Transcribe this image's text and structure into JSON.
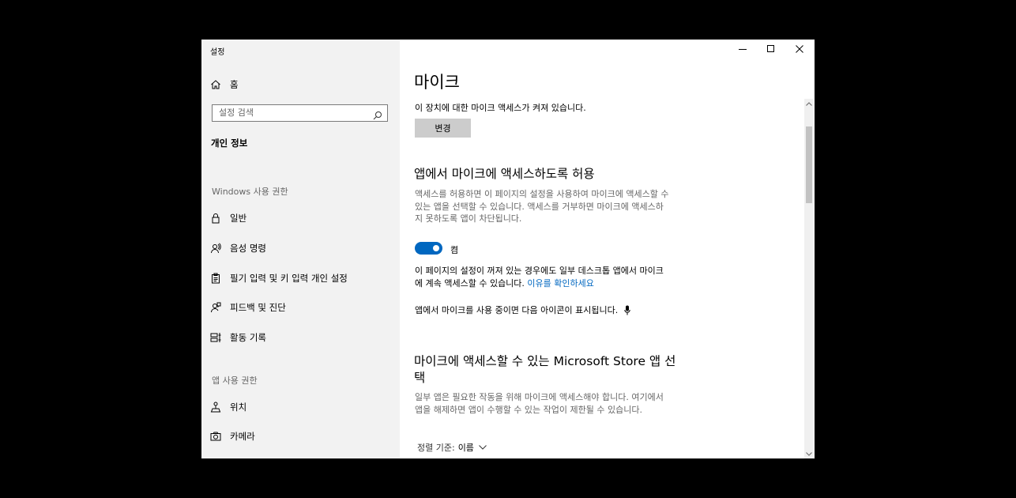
{
  "window": {
    "title": "설정",
    "controls": {
      "minimize": "minimize-icon",
      "maximize": "maximize-icon",
      "close": "close-icon"
    }
  },
  "sidebar": {
    "home": {
      "label": "홈",
      "icon": "home-icon"
    },
    "search": {
      "placeholder": "설정 검색",
      "value": "",
      "icon": "search-icon"
    },
    "category": "개인 정보",
    "sections": [
      {
        "title": "Windows 사용 권한",
        "items": [
          {
            "label": "일반",
            "icon": "lock-icon"
          },
          {
            "label": "음성 명령",
            "icon": "speech-icon"
          },
          {
            "label": "필기 입력 및 키 입력 개인 설정",
            "icon": "clipboard-icon"
          },
          {
            "label": "피드백 및 진단",
            "icon": "feedback-icon"
          },
          {
            "label": "활동 기록",
            "icon": "timeline-icon"
          }
        ]
      },
      {
        "title": "앱 사용 권한",
        "items": [
          {
            "label": "위치",
            "icon": "location-icon"
          },
          {
            "label": "카메라",
            "icon": "camera-icon"
          }
        ]
      }
    ]
  },
  "main": {
    "title": "마이크",
    "device_access_text": "이 장치에 대한 마이크 액세스가 켜져 있습니다.",
    "change_button": "변경",
    "allow_apps": {
      "heading": "앱에서 마이크에 액세스하도록 허용",
      "description_lines": [
        "액세스를 허용하면 이 페이지의 설정을 사용하여 마이크에 액세스할 수",
        "있는 앱을 선택할 수 있습니다. 액세스를 거부하면 마이크에 액세스하",
        "지 못하도록 앱이 차단됩니다."
      ],
      "toggle_state": "켬",
      "toggle_on": true
    },
    "desktop_note_line1": "이 페이지의 설정이 꺼져 있는 경우에도 일부 데스크톱 앱에서 마이크",
    "desktop_note_line2": "에 계속 액세스할 수 있습니다. ",
    "desktop_note_link": "이유를 확인하세요",
    "icon_note": "앱에서 마이크를 사용 중이면 다음 아이콘이 표시됩니다.",
    "icon_note_icon": "microphone-icon",
    "store": {
      "heading_line1": "마이크에 액세스할 수 있는 Microsoft Store 앱 선",
      "heading_line2": "택",
      "description_lines": [
        "일부 앱은 필요한 작동을 위해 마이크에 액세스해야 합니다. 여기에서",
        "앱을 해제하면 앱이 수행할 수 있는 작업이 제한될 수 있습니다."
      ]
    },
    "sort": {
      "label": "정렬 기준:",
      "value": "이름"
    }
  },
  "colors": {
    "accent": "#0067c0",
    "sidebar_bg": "#f2f2f2",
    "button_bg": "#cccccc"
  }
}
